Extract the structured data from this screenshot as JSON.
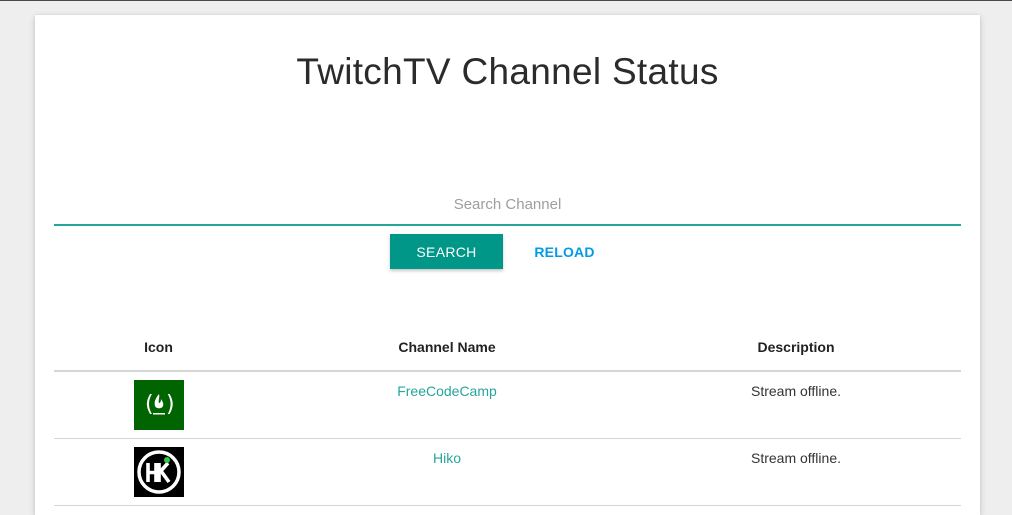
{
  "page": {
    "title": "TwitchTV Channel Status"
  },
  "search": {
    "placeholder": "Search Channel",
    "value": ""
  },
  "buttons": {
    "search_label": "SEARCH",
    "reload_label": "RELOAD"
  },
  "table": {
    "headers": [
      "Icon",
      "Channel Name",
      "Description"
    ],
    "rows": [
      {
        "icon": "freecodecamp-logo-icon",
        "name": "FreeCodeCamp",
        "description": "Stream offline."
      },
      {
        "icon": "hiko-logo-icon",
        "name": "Hiko",
        "description": "Stream offline."
      }
    ]
  },
  "colors": {
    "accent": "#26a69a",
    "search_button": "#009688",
    "reload_text": "#039be5",
    "freecodecamp_logo_bg": "#006400",
    "hiko_logo_bg": "#000000"
  }
}
